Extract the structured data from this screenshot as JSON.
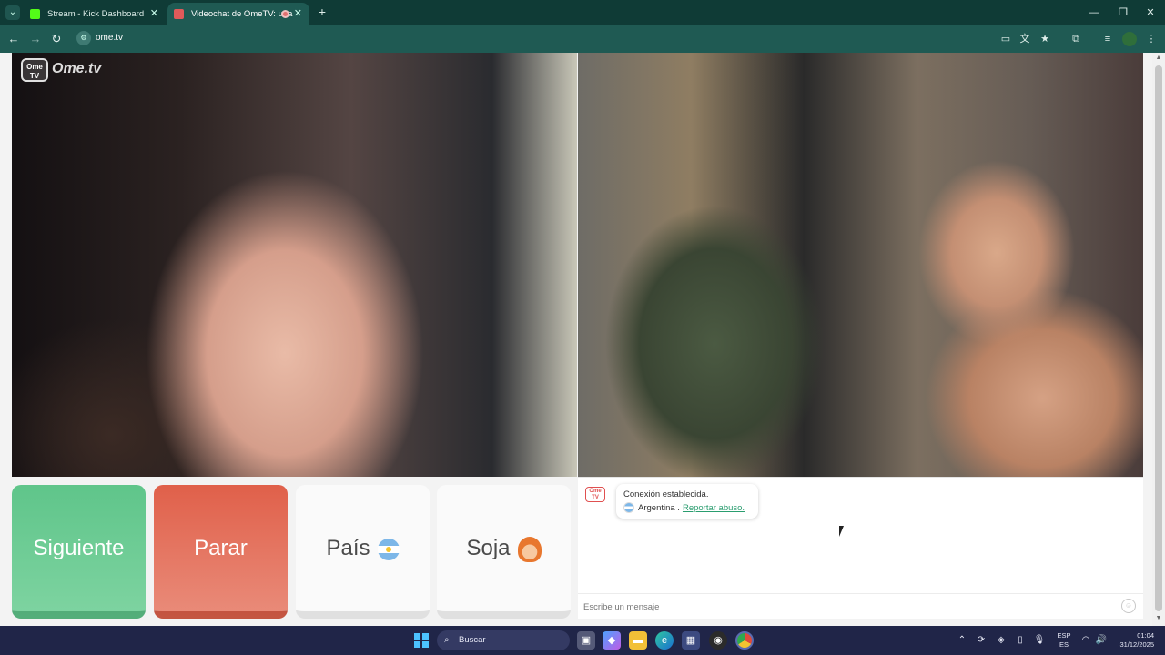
{
  "browser": {
    "tabs": [
      {
        "title": "Stream - Kick Dashboard",
        "favicon": "kick-icon",
        "active": false
      },
      {
        "title": "Videochat de OmeTV: una",
        "favicon": "ometv-icon",
        "active": true
      }
    ],
    "url": "ome.tv",
    "accent": "#1f5a53"
  },
  "page": {
    "logo_text": "Ome.tv",
    "logo_badge": "Ome TV",
    "buttons": {
      "next": "Siguiente",
      "stop": "Parar",
      "country": "País",
      "gender": "Soja"
    },
    "colors": {
      "next": "#5fc58a",
      "stop": "#e0604a"
    },
    "chat": {
      "status": "Conexión establecida.",
      "country": "Argentina .",
      "report_link": "Reportar abuso.",
      "input_placeholder": "Escribe un mensaje"
    }
  },
  "taskbar": {
    "search_label": "Buscar",
    "lang_line1": "ESP",
    "lang_line2": "ES",
    "time": "01:04",
    "date": "31/12/2025"
  }
}
